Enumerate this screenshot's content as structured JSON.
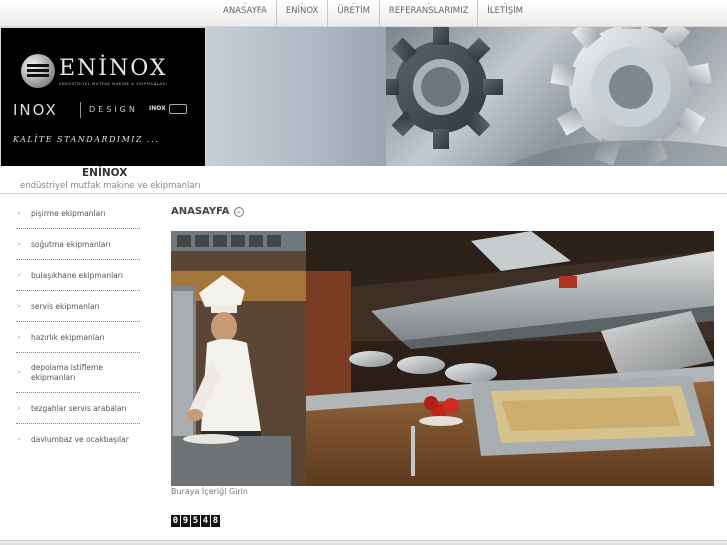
{
  "nav": {
    "items": [
      {
        "label": "ANASAYFA"
      },
      {
        "label": "ENİNOX"
      },
      {
        "label": "ÜRETİM"
      },
      {
        "label": "REFERANSLARIMIZ"
      },
      {
        "label": "İLETİŞİM"
      }
    ]
  },
  "header": {
    "logo_name": "ENİNOX",
    "logo_sub": "ENDÜSTRİYEL MUTFAK MAKİNE & EKİPMANLARI",
    "logo_inox": "INOX",
    "logo_design": "DESIGN",
    "logo_mini": "INOX",
    "tagline": "KALİTE STANDARDIMIZ ..."
  },
  "site": {
    "title": "ENİNOX",
    "subtitle": "endüstriyel mutfak makine ve ekipmanları"
  },
  "sidebar": {
    "items": [
      {
        "label": "pişirme ekipmanları"
      },
      {
        "label": "soğutma ekipmanları"
      },
      {
        "label": "bulaşıkhane ekipmanları"
      },
      {
        "label": "servis ekipmanları"
      },
      {
        "label": "hazırlık ekipmanları"
      },
      {
        "label": "depolama istifleme ekipmanları"
      },
      {
        "label": "tezgahlar servis arabaları"
      },
      {
        "label": "davlumbaz ve ocakbaşılar"
      }
    ]
  },
  "main": {
    "title": "ANASAYFA",
    "caption": "Buraya İçeriği Girin",
    "counter": [
      "0",
      "9",
      "5",
      "4",
      "8"
    ]
  },
  "colors": {
    "chef_white": "#f4f2ec",
    "steel": "#b8bcbd",
    "wood": "#8a5a32",
    "food_red": "#c0241c"
  }
}
